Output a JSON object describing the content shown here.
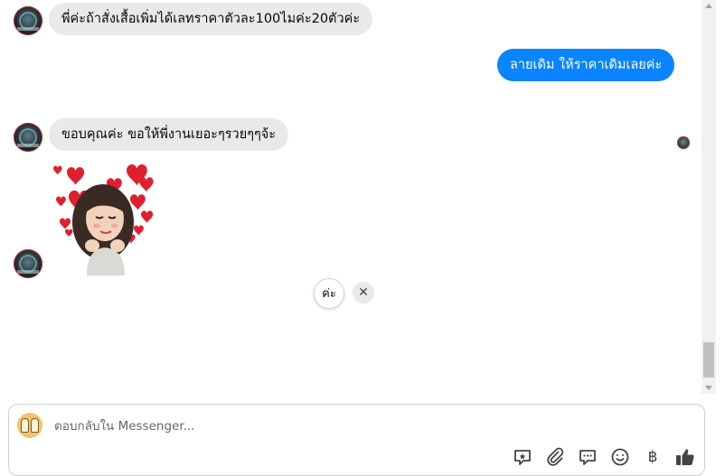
{
  "messages": [
    {
      "direction": "in",
      "text": "พี่ค่ะถ้าสั่งเสื้อเพิ่มได้เลทราคาตัวละ100ไมค่ะ20ตัวค่ะ"
    },
    {
      "direction": "out",
      "text": "ลายเดิม ให้ราคาเดิมเลยค่ะ"
    },
    {
      "direction": "in",
      "text": "ขอบคุณค่ะ ขอให้พี่งานเยอะๆรวยๆๆจ้ะ"
    },
    {
      "direction": "in",
      "type": "sticker",
      "sticker": "hearts-girl"
    }
  ],
  "quick_reply": {
    "label": "ค่ะ",
    "close_glyph": "✕"
  },
  "composer": {
    "placeholder": "ตอบกลับใน Messenger...",
    "value": "",
    "icons": [
      "quick-reply-icon",
      "attachment-icon",
      "comment-icon",
      "emoji-icon",
      "baht-icon",
      "like-icon"
    ],
    "baht_glyph": "฿"
  },
  "colors": {
    "outgoing_bubble": "#0a84ff",
    "incoming_bubble": "#e9e9eb",
    "icon": "#444444"
  }
}
